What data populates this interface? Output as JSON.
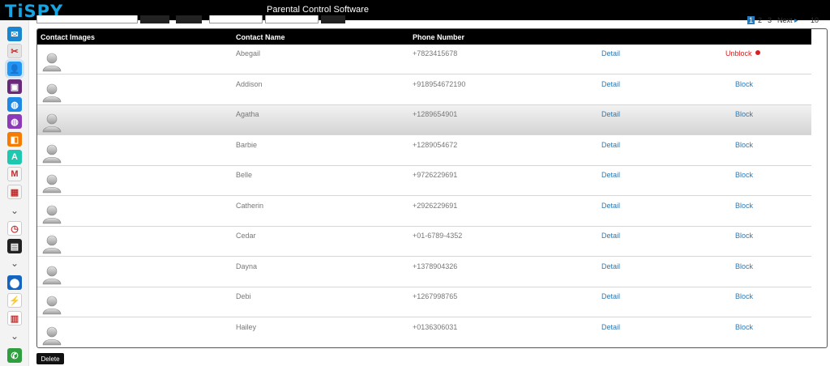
{
  "header": {
    "logo": "TiSPY",
    "title": "Parental Control Software"
  },
  "sidebar": {
    "icons": [
      {
        "name": "mail-icon",
        "color": "#1a86d0",
        "glyph": "✉"
      },
      {
        "name": "pictures-icon",
        "color": "#e4e4e4",
        "glyph": "✂"
      },
      {
        "name": "contacts-icon",
        "color": "#2196f3",
        "glyph": "👤"
      },
      {
        "name": "gallery-icon",
        "color": "#6a2a7a",
        "glyph": "▣"
      },
      {
        "name": "browser-icon",
        "color": "#1e88e5",
        "glyph": "◍"
      },
      {
        "name": "globe-icon",
        "color": "#8e3ab8",
        "glyph": "◍"
      },
      {
        "name": "apps-icon",
        "color": "#f57c00",
        "glyph": "◧"
      },
      {
        "name": "text-icon",
        "color": "#1ec7b0",
        "glyph": "A"
      },
      {
        "name": "gmail-icon",
        "color": "#f5f5f5",
        "glyph": "M"
      },
      {
        "name": "calendar-icon",
        "color": "#f5f5f5",
        "glyph": "▦"
      },
      {
        "name": "clock-icon",
        "color": "#ffffff",
        "glyph": "◷"
      },
      {
        "name": "notes-icon",
        "color": "#222222",
        "glyph": "▤"
      },
      {
        "name": "location-icon",
        "color": "#1565c0",
        "glyph": "⬤"
      },
      {
        "name": "keylogger-icon",
        "color": "#ffffff",
        "glyph": "⚡"
      },
      {
        "name": "fence-icon",
        "color": "#ffffff",
        "glyph": "▥"
      },
      {
        "name": "whatsapp-icon",
        "color": "#2e9e3e",
        "glyph": "✆"
      }
    ],
    "chevron": "⌄"
  },
  "pager": {
    "current": "1",
    "p2": "2",
    "p3": "3",
    "next": "Next",
    "next_arrow": "▸",
    "per_page": "10"
  },
  "table": {
    "headers": {
      "images": "Contact Images",
      "name": "Contact Name",
      "phone": "Phone Number"
    },
    "detail_label": "Detail",
    "rows": [
      {
        "name": "Abegail",
        "phone": "+7823415678",
        "action": "Unblock",
        "blocked": true
      },
      {
        "name": "Addison",
        "phone": "+918954672190",
        "action": "Block",
        "blocked": false
      },
      {
        "name": "Agatha",
        "phone": "+1289654901",
        "action": "Block",
        "blocked": false
      },
      {
        "name": "Barbie",
        "phone": "+1289054672",
        "action": "Block",
        "blocked": false
      },
      {
        "name": "Belle",
        "phone": "+9726229691",
        "action": "Block",
        "blocked": false
      },
      {
        "name": "Catherin",
        "phone": "+2926229691",
        "action": "Block",
        "blocked": false
      },
      {
        "name": "Cedar",
        "phone": "+01-6789-4352",
        "action": "Block",
        "blocked": false
      },
      {
        "name": "Dayna",
        "phone": "+1378904326",
        "action": "Block",
        "blocked": false
      },
      {
        "name": "Debi",
        "phone": "+1267998765",
        "action": "Block",
        "blocked": false
      },
      {
        "name": "Hailey",
        "phone": "+0136306031",
        "action": "Block",
        "blocked": false
      }
    ]
  },
  "delete_label": "Delete"
}
